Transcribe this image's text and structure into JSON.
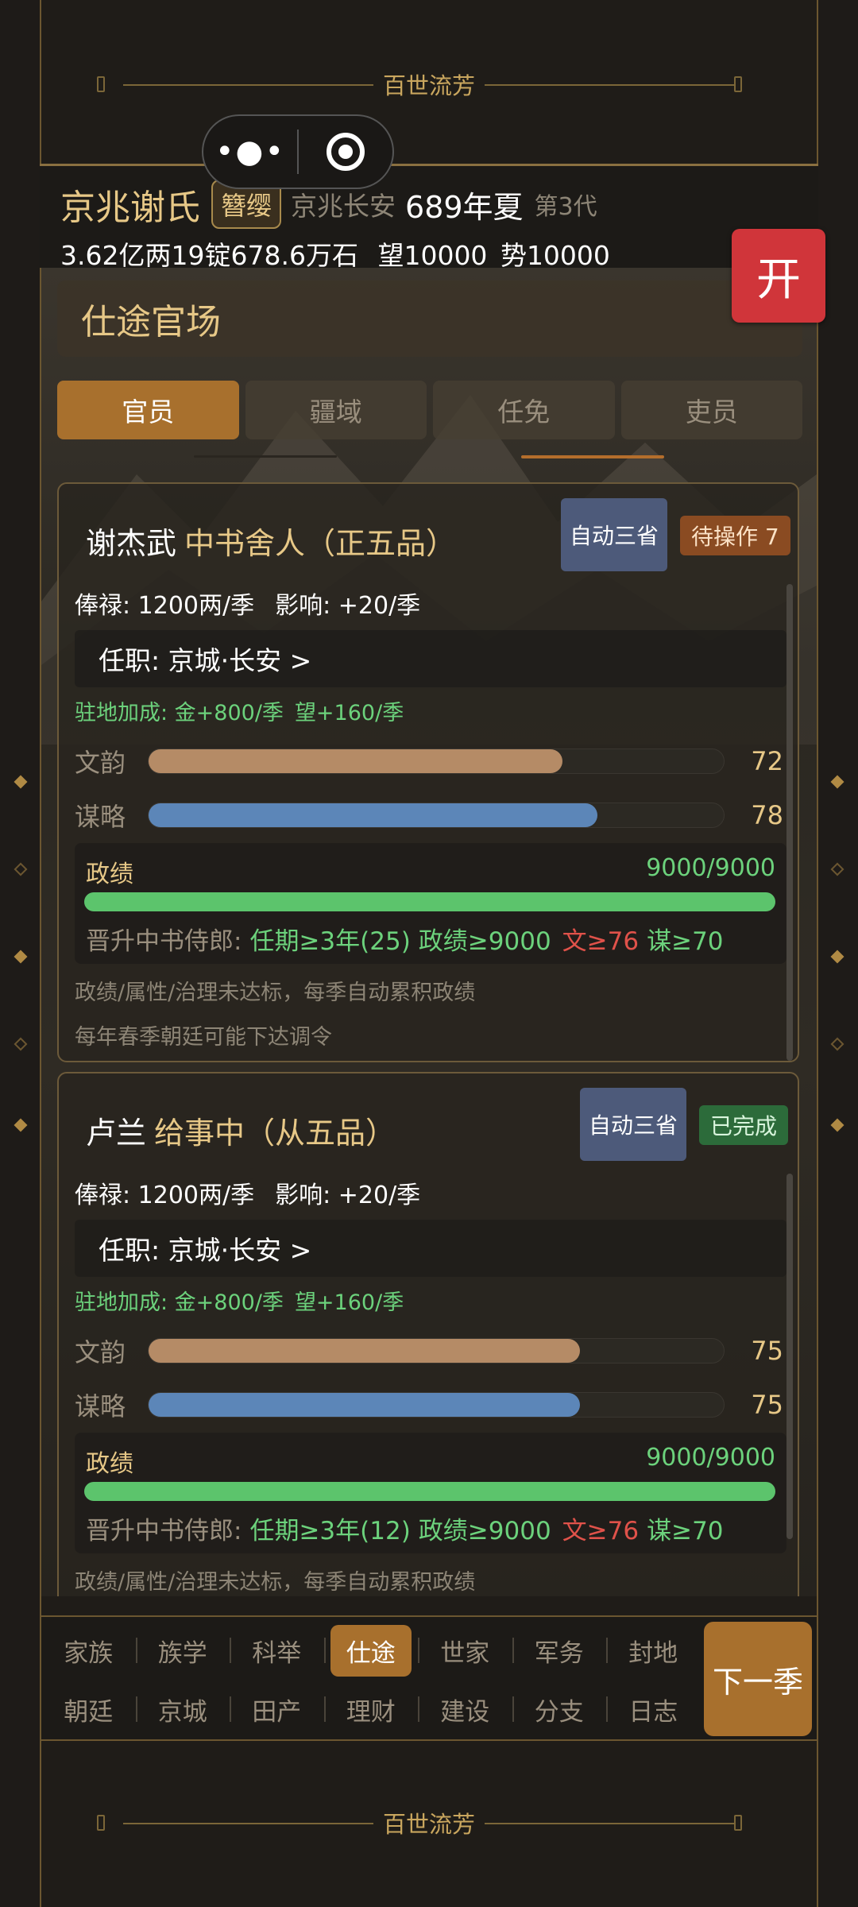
{
  "frame_title": "百世流芳",
  "header": {
    "clan": "京兆谢氏",
    "rank_badge": "簪缨",
    "location": "京兆长安",
    "year": "689年夏",
    "generation": "第3代",
    "resources": "3.62亿两19锭678.6万石",
    "prestige": "望10000",
    "power": "势10000"
  },
  "open_button": "开",
  "section_title": "仕途官场",
  "tabs": [
    {
      "label": "官员",
      "active": true
    },
    {
      "label": "疆域",
      "active": false
    },
    {
      "label": "任免",
      "active": false
    },
    {
      "label": "吏员",
      "active": false
    }
  ],
  "officials": [
    {
      "name": "谢杰武",
      "position": "中书舍人（正五品）",
      "auto_label": "自动三省",
      "status": "待操作 7",
      "salary": "俸禄: 1200两/季",
      "influence": "影响: +20/季",
      "post": "任职: 京城·长安  >",
      "bonus_gold": "驻地加成: 金+800/季",
      "bonus_prestige": "望+160/季",
      "stats": [
        {
          "label": "文韵",
          "value": 72,
          "display": "72",
          "color": "#b58b66"
        },
        {
          "label": "谋略",
          "value": 78,
          "display": "78",
          "color": "#5c86b8"
        }
      ],
      "perf_label": "政绩",
      "perf_value": "9000/9000",
      "perf_fraction": 1.0,
      "promote_to": "晋升中书侍郎:",
      "req_tenure": "任期≥3年(25)",
      "req_perf": "政绩≥9000",
      "req_wen": "文≥76",
      "req_mou": "谋≥70",
      "notes": [
        "政绩/属性/治理未达标，每季自动累积政绩",
        "每年春季朝廷可能下达调令"
      ]
    },
    {
      "name": "卢兰",
      "position": "给事中（从五品）",
      "auto_label": "自动三省",
      "status": "已完成",
      "salary": "俸禄: 1200两/季",
      "influence": "影响: +20/季",
      "post": "任职: 京城·长安  >",
      "bonus_gold": "驻地加成: 金+800/季",
      "bonus_prestige": "望+160/季",
      "stats": [
        {
          "label": "文韵",
          "value": 75,
          "display": "75",
          "color": "#b58b66"
        },
        {
          "label": "谋略",
          "value": 75,
          "display": "75",
          "color": "#5c86b8"
        }
      ],
      "perf_label": "政绩",
      "perf_value": "9000/9000",
      "perf_fraction": 1.0,
      "promote_to": "晋升中书侍郎:",
      "req_tenure": "任期≥3年(12)",
      "req_perf": "政绩≥9000",
      "req_wen": "文≥76",
      "req_mou": "谋≥70",
      "notes": [
        "政绩/属性/治理未达标，每季自动累积政绩"
      ]
    }
  ],
  "nav": {
    "row1": [
      "家族",
      "族学",
      "科举",
      "仕途",
      "世家",
      "军务",
      "封地"
    ],
    "row2": [
      "朝廷",
      "京城",
      "田产",
      "理财",
      "建设",
      "分支",
      "日志"
    ],
    "active": "仕途",
    "next_season": "下一季"
  }
}
